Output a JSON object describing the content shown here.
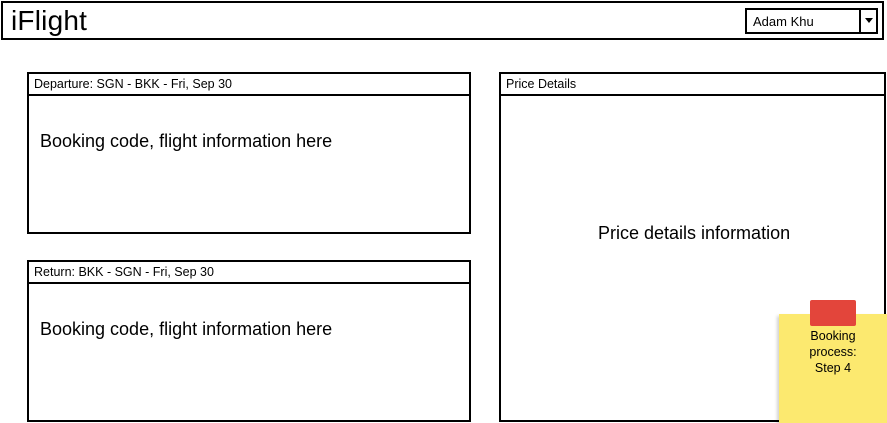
{
  "app": {
    "title": "iFlight"
  },
  "header": {
    "user_selector": {
      "selected": "Adam Khu"
    }
  },
  "departure_panel": {
    "header": "Departure: SGN - BKK - Fri, Sep 30",
    "body": "Booking code, flight information here"
  },
  "return_panel": {
    "header": "Return: BKK - SGN - Fri, Sep 30",
    "body": "Booking code, flight information here"
  },
  "price_panel": {
    "header": "Price Details",
    "body": "Price details information"
  },
  "sticky_note": {
    "text": "Booking\nprocess:\nStep 4",
    "color": "#fce96f",
    "tape_color": "#e3453b"
  },
  "icons": {
    "user_selector_dropdown": "chevron-down-icon"
  }
}
